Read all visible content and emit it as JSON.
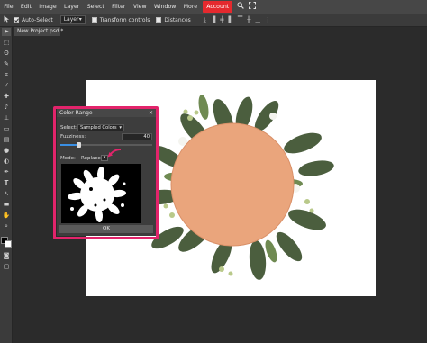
{
  "menubar": {
    "items": [
      "File",
      "Edit",
      "Image",
      "Layer",
      "Select",
      "Filter",
      "View",
      "Window",
      "More",
      "Account"
    ],
    "icons": [
      "search-icon",
      "fullscreen-icon"
    ]
  },
  "options": {
    "auto_select_label": "Auto-Select",
    "layer_select_value": "Layer",
    "transform_label": "Transform controls",
    "distances_label": "Distances",
    "icons": [
      "download-icon",
      "align-left-icon",
      "align-center-icon",
      "align-right-icon",
      "align-top-icon",
      "align-middle-icon",
      "align-bottom-icon",
      "distribute-icon"
    ]
  },
  "document": {
    "tab_label": "New Project.psd *"
  },
  "toolbar": {
    "tools": [
      "move-tool-icon",
      "marquee-tool-icon",
      "lasso-tool-icon",
      "quick-select-tool-icon",
      "crop-tool-icon",
      "eyedropper-tool-icon",
      "healing-tool-icon",
      "brush-tool-icon",
      "clone-tool-icon",
      "eraser-tool-icon",
      "gradient-tool-icon",
      "blur-tool-icon",
      "dodge-tool-icon",
      "pen-tool-icon",
      "type-tool-icon",
      "path-select-tool-icon",
      "shape-tool-icon",
      "hand-tool-icon",
      "zoom-tool-icon"
    ],
    "colors": {
      "foreground": "#000000",
      "background": "#ffffff"
    }
  },
  "dialog": {
    "title": "Color Range",
    "select_label": "Select:",
    "select_value": "Sampled Colors",
    "fuzziness_label": "Fuzziness:",
    "fuzziness_value": "40",
    "fuzziness_level": 0.2,
    "mode_label": "Mode:",
    "mode_value": "Replace",
    "ok_label": "OK"
  },
  "colors": {
    "accent": "#e4292e",
    "highlight_frame": "#e2246b",
    "slider": "#3a8fe3",
    "plate": "#eaa57c"
  }
}
